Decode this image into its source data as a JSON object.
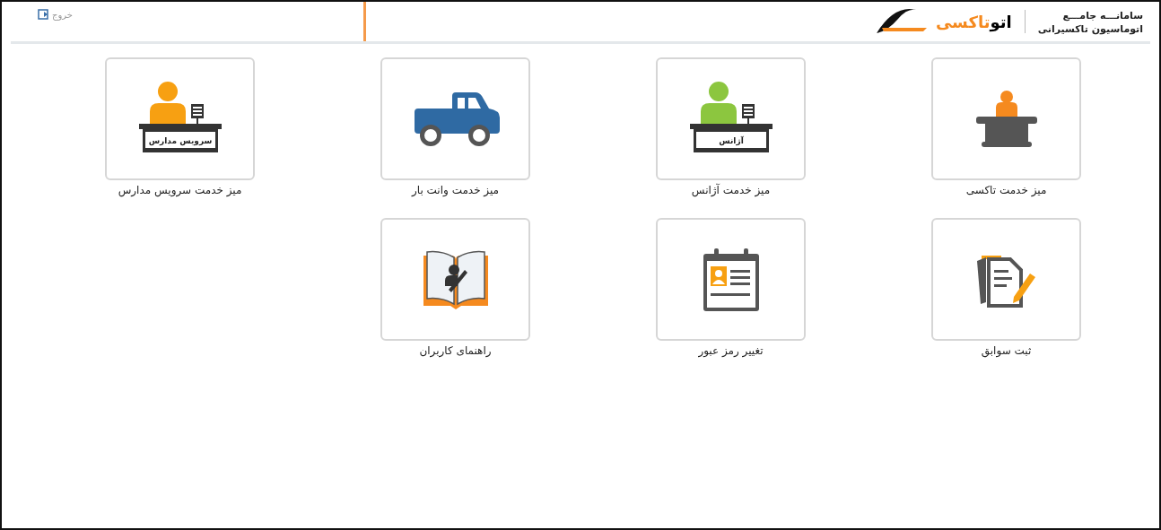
{
  "header": {
    "system_title": "سامانـــه جامـــع",
    "system_subtitle": "اتوماسیون تاکسیرانی",
    "logo_words": [
      "اتو",
      "تاکسی"
    ],
    "logout": "خروج"
  },
  "tiles": [
    {
      "label": "میز خدمت تاکسی",
      "kind": "taxi-desk"
    },
    {
      "label": "میز خدمت آژانس",
      "kind": "agency-desk",
      "sign": "آژانس"
    },
    {
      "label": "میز خدمت وانت بار",
      "kind": "truck"
    },
    {
      "label": "میز خدمت سرویس مدارس",
      "kind": "school-desk",
      "sign": "سرویس مدارس"
    },
    {
      "label": "ثبت سوابق",
      "kind": "documents"
    },
    {
      "label": "تغییر رمز عبور",
      "kind": "id-card"
    },
    {
      "label": "راهنمای کاربران",
      "kind": "book"
    }
  ]
}
